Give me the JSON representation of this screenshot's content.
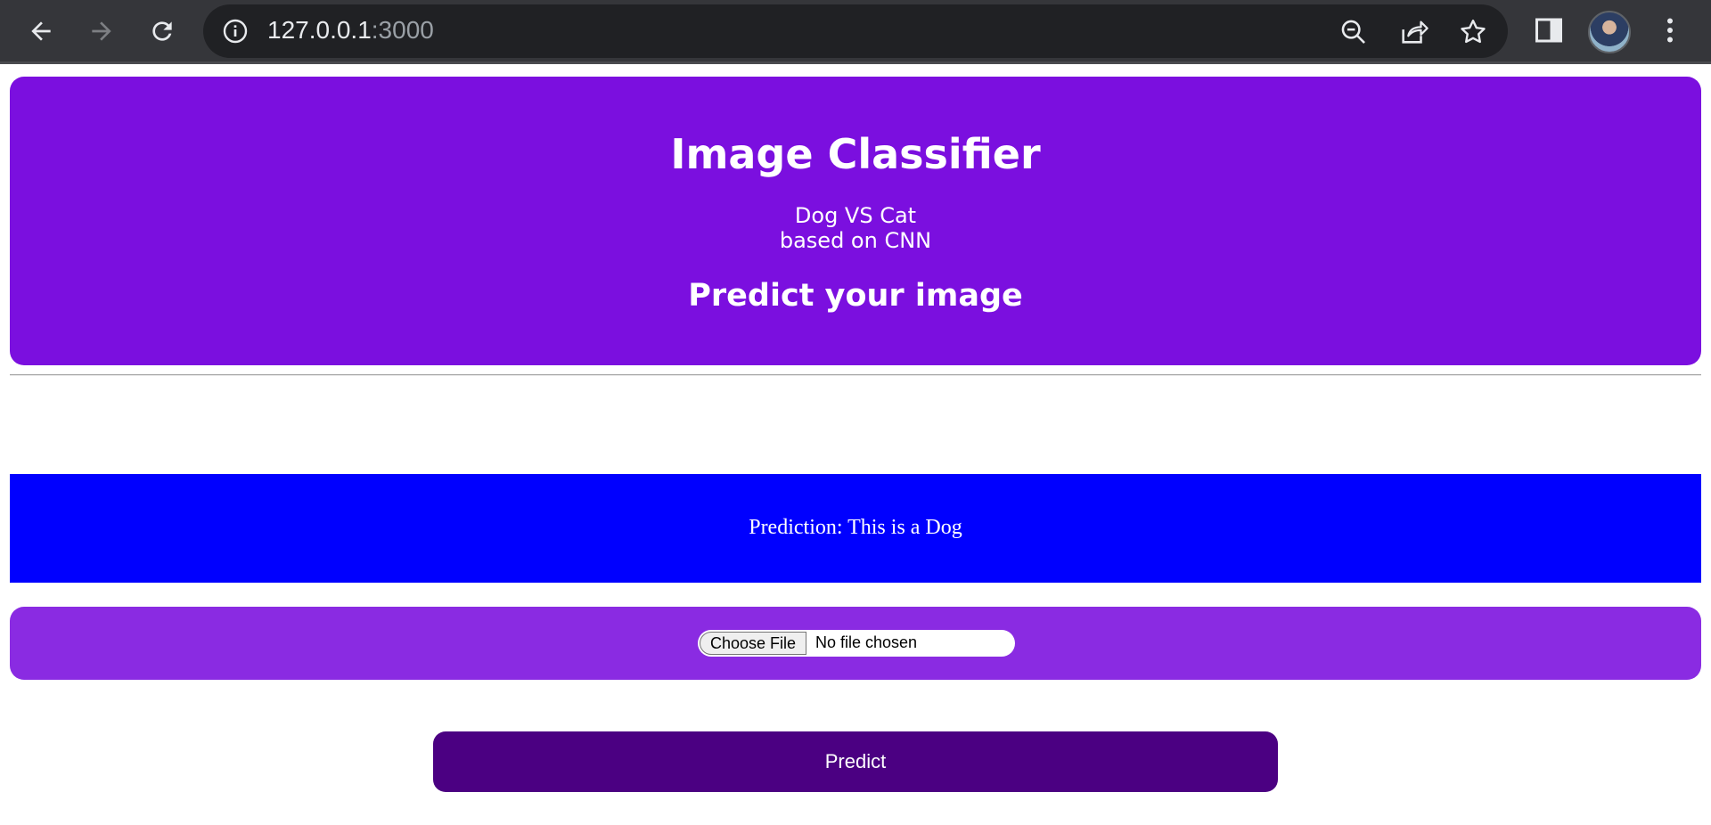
{
  "browser": {
    "url_host": "127.0.0.1",
    "url_port": ":3000"
  },
  "hero": {
    "title": "Image Classifier",
    "subtitle_line1": "Dog VS Cat",
    "subtitle_line2": "based on CNN",
    "heading": "Predict your image"
  },
  "result": {
    "text": "Prediction: This is a Dog"
  },
  "upload": {
    "button_label": "Choose File",
    "status": "No file chosen"
  },
  "predict_button": {
    "label": "Predict"
  },
  "colors": {
    "hero_bg": "#7b0fdf",
    "result_bg": "#0000ff",
    "upload_bg": "#8a2be2",
    "predict_bg": "#4b0082"
  }
}
